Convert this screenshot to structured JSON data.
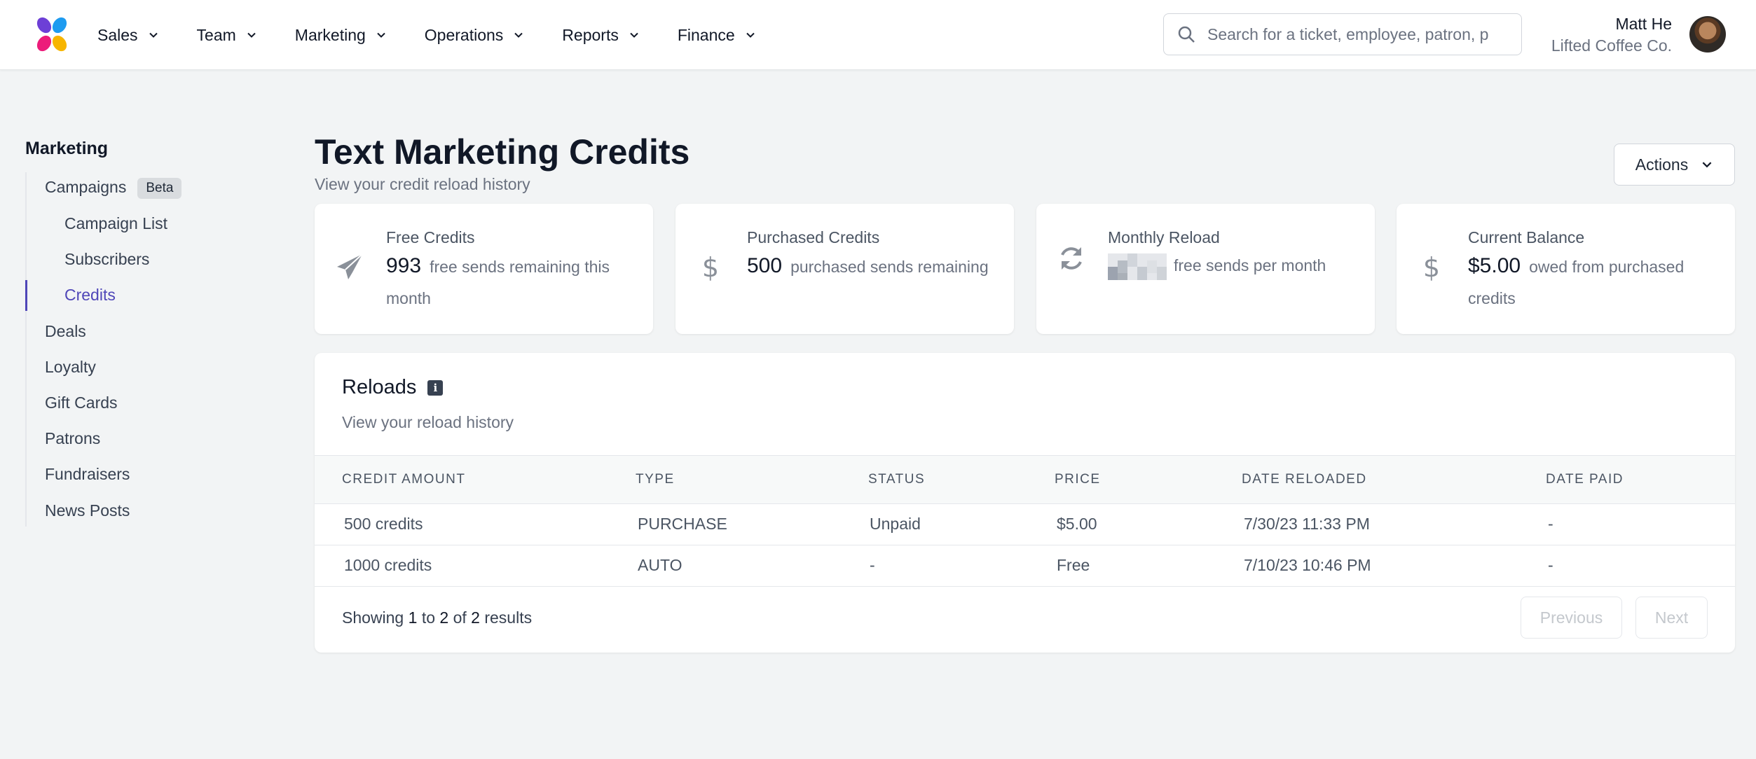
{
  "header": {
    "nav": [
      {
        "label": "Sales"
      },
      {
        "label": "Team"
      },
      {
        "label": "Marketing"
      },
      {
        "label": "Operations"
      },
      {
        "label": "Reports"
      },
      {
        "label": "Finance"
      }
    ],
    "search": {
      "placeholder": "Search for a ticket, employee, patron, p",
      "value": ""
    },
    "user": {
      "name": "Matt He",
      "company": "Lifted Coffee Co."
    }
  },
  "sidebar": {
    "title": "Marketing",
    "items": [
      {
        "label": "Campaigns",
        "badge": "Beta"
      },
      {
        "label": "Campaign List"
      },
      {
        "label": "Subscribers"
      },
      {
        "label": "Credits"
      },
      {
        "label": "Deals"
      },
      {
        "label": "Loyalty"
      },
      {
        "label": "Gift Cards"
      },
      {
        "label": "Patrons"
      },
      {
        "label": "Fundraisers"
      },
      {
        "label": "News Posts"
      }
    ],
    "active_color": "#4f46b8"
  },
  "main": {
    "title": "Text Marketing Credits",
    "subtitle": "View your credit reload history",
    "actions_label": "Actions",
    "cards": [
      {
        "label": "Free Credits",
        "value": "993",
        "suffix": "free sends remaining this month",
        "icon": "paper-plane-icon"
      },
      {
        "label": "Purchased Credits",
        "value": "500",
        "suffix": "purchased sends remaining",
        "icon": "dollar-icon"
      },
      {
        "label": "Monthly Reload",
        "value": "",
        "suffix": "free sends per month",
        "icon": "refresh-icon"
      },
      {
        "label": "Current Balance",
        "value": "$5.00",
        "suffix": "owed from purchased credits",
        "icon": "dollar-icon"
      }
    ],
    "reloads": {
      "title": "Reloads",
      "subtitle": "View your reload history",
      "columns": [
        "CREDIT AMOUNT",
        "TYPE",
        "STATUS",
        "PRICE",
        "DATE RELOADED",
        "DATE PAID"
      ],
      "rows": [
        [
          "500 credits",
          "PURCHASE",
          "Unpaid",
          "$5.00",
          "7/30/23 11:33 PM",
          "-"
        ],
        [
          "1000 credits",
          "AUTO",
          "-",
          "Free",
          "7/10/23 10:46 PM",
          "-"
        ]
      ],
      "pagination": {
        "showing": "Showing",
        "from": "1",
        "to_word": "to",
        "to": "2",
        "of_word": "of",
        "total": "2",
        "results_word": "results",
        "previous_label": "Previous",
        "next_label": "Next"
      }
    }
  }
}
